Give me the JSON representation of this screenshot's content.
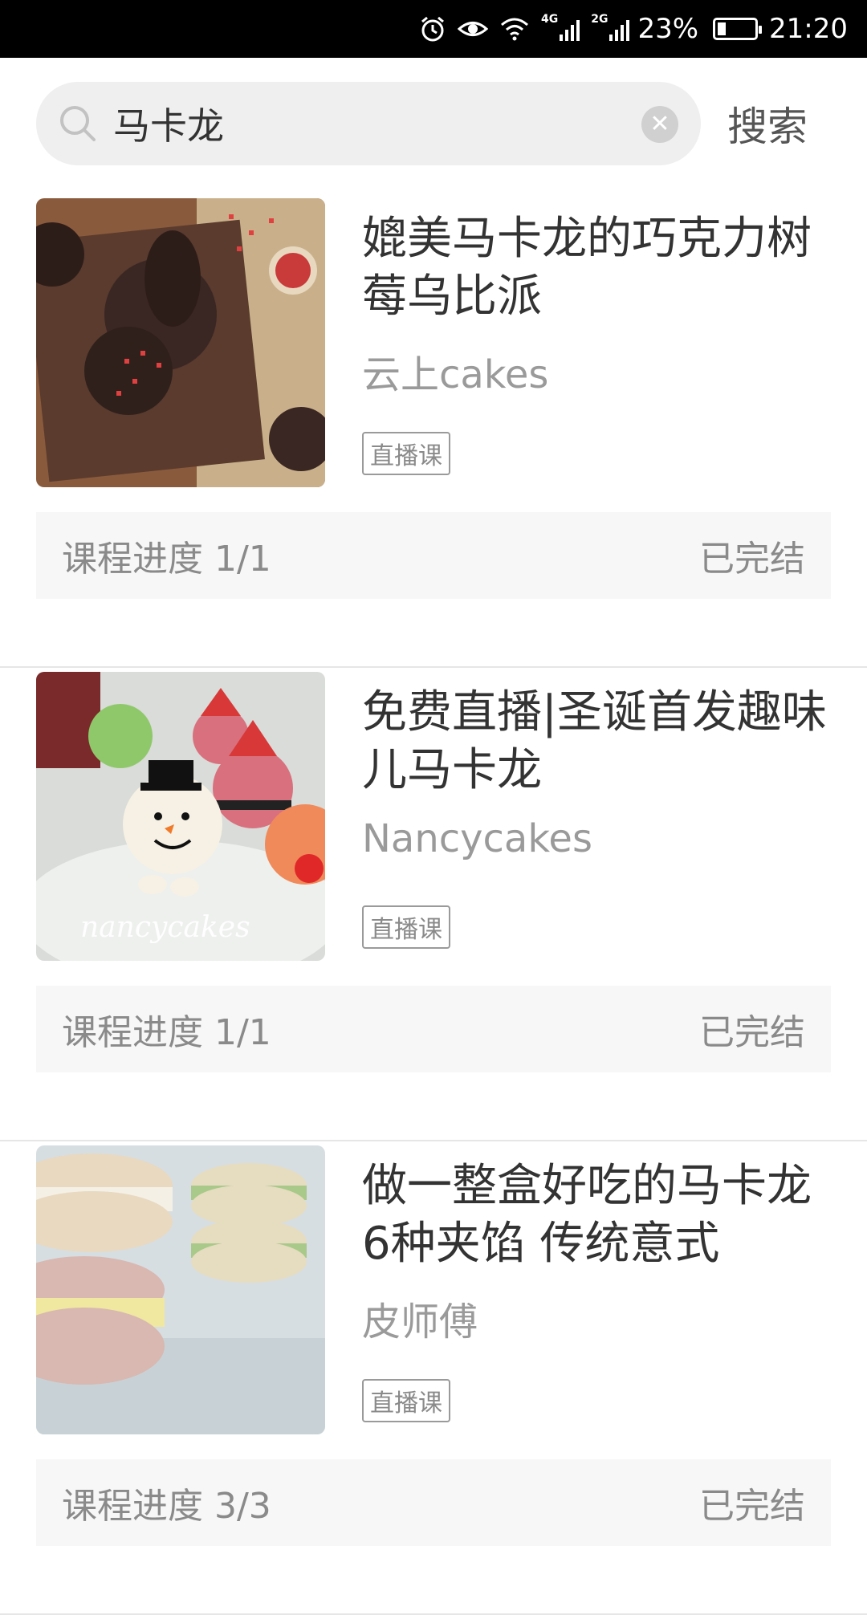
{
  "status_bar": {
    "network_1": "4G",
    "network_2": "2G",
    "battery": "23%",
    "battery_level": 0.23,
    "time": "21:20"
  },
  "search": {
    "query": "马卡龙",
    "button_label": "搜索"
  },
  "courses": [
    {
      "title": "媲美马卡龙的巧克力树莓乌比派",
      "author": "云上cakes",
      "tag": "直播课",
      "progress": "课程进度 1/1",
      "status": "已完结"
    },
    {
      "title": "免费直播|圣诞首发趣味儿马卡龙",
      "author": "Nancycakes",
      "tag": "直播课",
      "progress": "课程进度 1/1",
      "status": "已完结",
      "image_watermark": "nancycakes"
    },
    {
      "title": "做一整盒好吃的马卡龙 6种夹馅 传统意式",
      "author": "皮师傅",
      "tag": "直播课",
      "progress": "课程进度 3/3",
      "status": "已完结"
    }
  ]
}
